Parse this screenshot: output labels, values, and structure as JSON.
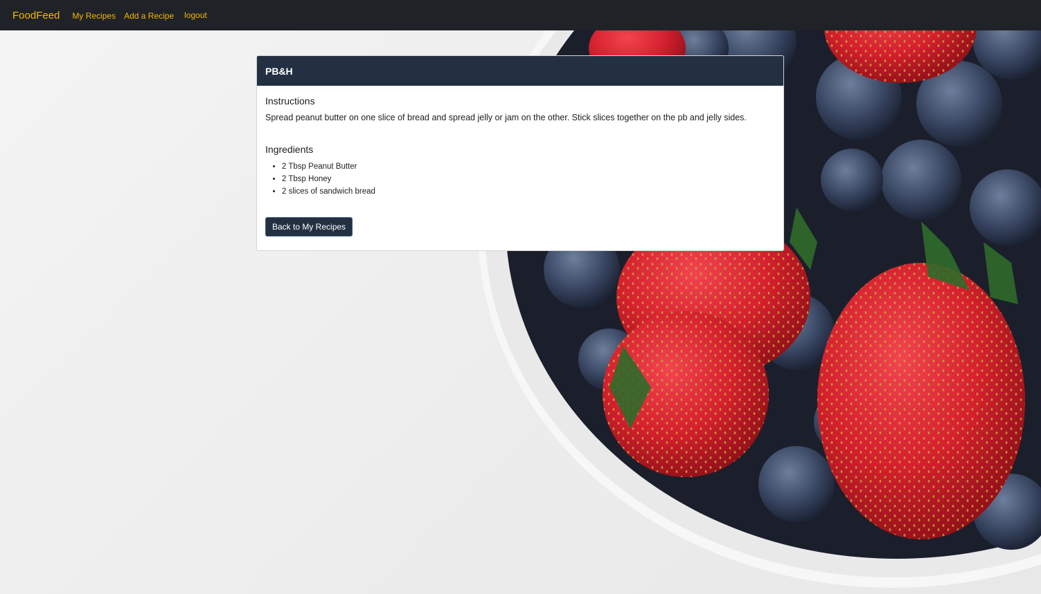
{
  "navbar": {
    "brand": "FoodFeed",
    "links": {
      "my_recipes": "My Recipes",
      "add_recipe": "Add a Recipe",
      "logout": "logout"
    }
  },
  "recipe": {
    "title": "PB&H",
    "instructions_heading": "Instructions",
    "instructions_text": "Spread peanut butter on one slice of bread and spread jelly or jam on the other. Stick slices together on the pb and jelly sides.",
    "ingredients_heading": "Ingredients",
    "ingredients": [
      "2 Tbsp Peanut Butter",
      "2 Tbsp Honey",
      "2 slices of sandwich bread"
    ],
    "back_button": "Back to My Recipes"
  },
  "colors": {
    "navbar_bg": "#1f2226",
    "nav_accent": "#f5b800",
    "card_header_bg": "#233042",
    "button_bg": "#233042"
  }
}
